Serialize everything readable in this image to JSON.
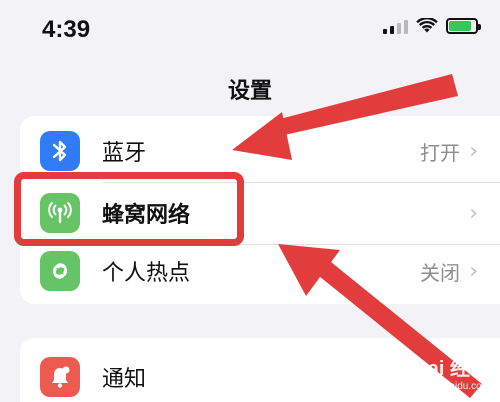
{
  "status_bar": {
    "time": "4:39",
    "battery_level": 0.85,
    "signal_bars_on": 2,
    "signal_bars_total": 4,
    "icons": [
      "cellular-signal-icon",
      "wifi-icon",
      "battery-charging-icon"
    ]
  },
  "nav": {
    "title": "设置"
  },
  "settings": {
    "items": [
      {
        "label": "蓝牙",
        "value": "打开",
        "icon": "bluetooth-icon",
        "color": "#2f7cf6"
      },
      {
        "label": "蜂窝网络",
        "value": "",
        "icon": "cellular-antenna-icon",
        "color": "#65c466"
      },
      {
        "label": "个人热点",
        "value": "关闭",
        "icon": "hotspot-link-icon",
        "color": "#65c466"
      }
    ],
    "group2": [
      {
        "label": "通知",
        "icon": "bell-icon",
        "color": "#ec5b4f"
      }
    ]
  },
  "annotations": {
    "highlight_color": "#e23c3c",
    "arrow_color": "#e23c3c"
  },
  "watermark": {
    "main": "Bai 经验",
    "sub": "jingyan.baidu.com"
  }
}
